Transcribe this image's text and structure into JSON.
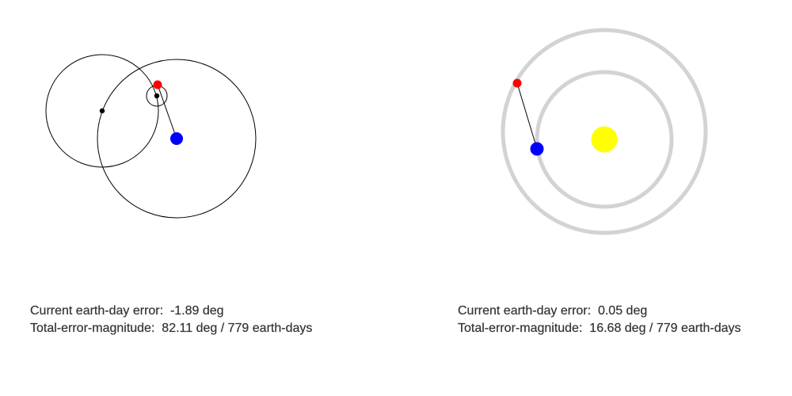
{
  "colors": {
    "orbit_line": "#000000",
    "track_ring": "#d3d3d3",
    "planet_red": "#ff0000",
    "planet_blue": "#0000ff",
    "sun": "#ffff00",
    "epicycle_point": "#000000",
    "text": "#333333"
  },
  "left_model": {
    "current_error": {
      "label": "Current earth-day error:",
      "value": "-1.89 deg"
    },
    "total_error": {
      "label": "Total-error-magnitude:",
      "value": "82.11 deg / 779 earth-days"
    }
  },
  "right_model": {
    "current_error": {
      "label": "Current earth-day error:",
      "value": "0.05 deg"
    },
    "total_error": {
      "label": "Total-error-magnitude:",
      "value": "16.68 deg / 779 earth-days"
    }
  }
}
